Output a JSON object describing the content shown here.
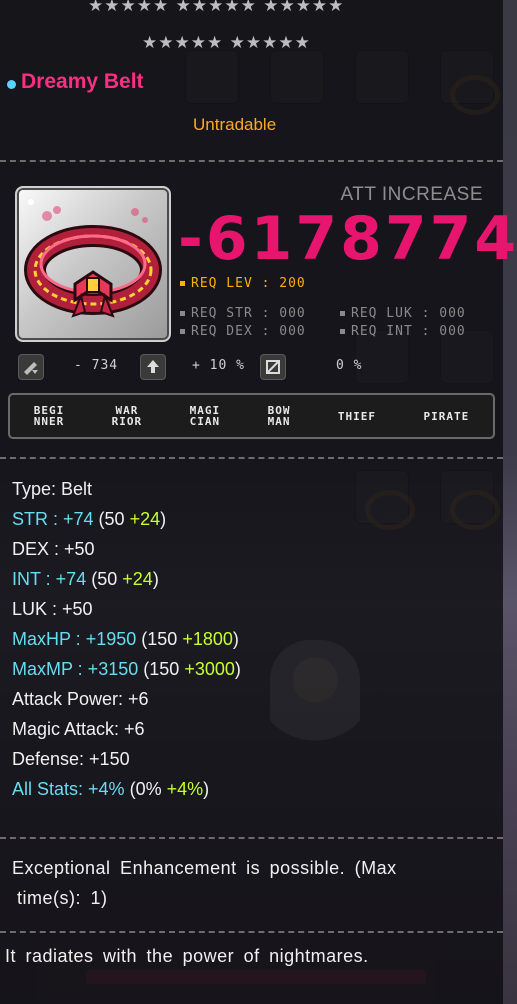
{
  "item": {
    "stars_row1": "★★★★★ ★★★★★ ★★★★★",
    "stars_row2": "★★★★★ ★★★★★",
    "name": "Dreamy Belt",
    "trade_status": "Untradable"
  },
  "att_increase": {
    "label": "ATT INCREASE",
    "value": "-6178774"
  },
  "requirements": {
    "lev": "REQ LEV : 200",
    "str": "REQ STR : 000",
    "luk": "REQ LUK : 000",
    "dex": "REQ DEX : 000",
    "int": "REQ INT : 000"
  },
  "indicators": {
    "value1": "- 734",
    "value2": "+ 10 %",
    "value3": "0 %"
  },
  "jobs": [
    {
      "line1": "BEGI",
      "line2": "NNER"
    },
    {
      "line1": "WAR",
      "line2": "RIOR"
    },
    {
      "line1": "MAGI",
      "line2": "CIAN"
    },
    {
      "line1": "BOW",
      "line2": "MAN"
    },
    {
      "line1": "THIEF",
      "line2": ""
    },
    {
      "line1": "PIRATE",
      "line2": ""
    }
  ],
  "stats": {
    "type": "Type: Belt",
    "str": {
      "label": "STR : +74",
      "base": "50",
      "bonus": "+24"
    },
    "dex": "DEX : +50",
    "int": {
      "label": "INT : +74",
      "base": "50",
      "bonus": "+24"
    },
    "luk": "LUK : +50",
    "maxhp": {
      "label": "MaxHP : +1950",
      "base": "150",
      "bonus": "+1800"
    },
    "maxmp": {
      "label": "MaxMP : +3150",
      "base": "150",
      "bonus": "+3000"
    },
    "attack": "Attack Power: +6",
    "magic": "Magic Attack: +6",
    "defense": "Defense: +150",
    "allstats": {
      "label": "All Stats: +4%",
      "base": "0%",
      "bonus": "+4%"
    }
  },
  "description": {
    "enhancement_line1": "Exceptional Enhancement is possible. (Max",
    "enhancement_line2": "time(s): 1)",
    "flavor": "It radiates with the power of nightmares."
  },
  "colors": {
    "name": "#ff2e82",
    "att_value": "#e8156e",
    "cyan_stat": "#66ddf0",
    "green_bonus": "#c6ff2e",
    "untradable": "#ffaa22"
  }
}
